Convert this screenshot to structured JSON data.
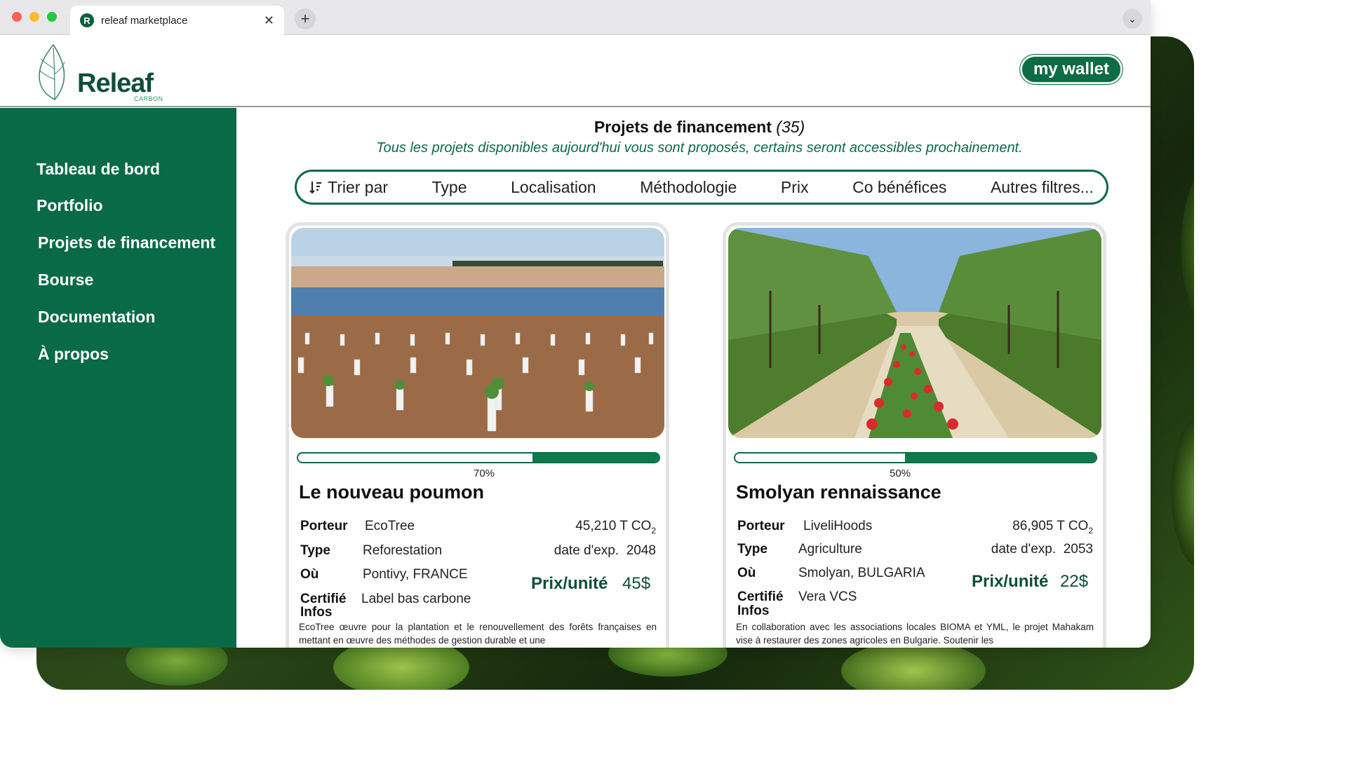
{
  "browser": {
    "tab_title": "releaf marketplace",
    "favicon_letter": "R",
    "close_glyph": "✕",
    "newtab_glyph": "+",
    "menu_glyph": "⌄"
  },
  "header": {
    "logo_name": "Releaf",
    "logo_sub": "CARBON",
    "wallet_label": "my wallet"
  },
  "sidebar": {
    "items": [
      {
        "label": "Tableau de bord"
      },
      {
        "label": "Portfolio"
      },
      {
        "label": "Projets de financement"
      },
      {
        "label": "Bourse"
      },
      {
        "label": "Documentation"
      },
      {
        "label": "À propos"
      }
    ]
  },
  "main": {
    "heading": "Projets de financement",
    "count": "(35)",
    "subtitle": "Tous les projets disponibles aujourd'hui vous sont proposés, certains seront accessibles prochainement.",
    "filters": {
      "sort": "Trier par",
      "type": "Type",
      "location": "Localisation",
      "methodology": "Méthodologie",
      "price": "Prix",
      "cobenefits": "Co bénéfices",
      "others": "Autres filtres..."
    }
  },
  "colors": {
    "brand_green": "#0d6b45",
    "sidebar_green": "#086b45"
  },
  "projects": [
    {
      "progress_pct": "70%",
      "progress_fraction": 0.7,
      "title": "Le nouveau poumon",
      "porteur_label": "Porteur",
      "porteur": "EcoTree",
      "type_label": "Type",
      "type": "Reforestation",
      "ou_label": "Où",
      "ou": "Pontivy, FRANCE",
      "certifie_label": "Certifié",
      "certifie": "Label bas carbone",
      "infos_label": "Infos",
      "co2": "45,210 T CO",
      "co2_sub": "2",
      "exp_label": "date d'exp.",
      "exp": "2048",
      "price_label": "Prix/unité",
      "price": "45$",
      "info": "EcoTree œuvre pour la plantation et le renouvellement des forêts françaises en mettant en œuvre des méthodes de gestion durable et une"
    },
    {
      "progress_pct": "50%",
      "progress_fraction": 0.5,
      "title": "Smolyan rennaissance",
      "porteur_label": "Porteur",
      "porteur": "LiveliHoods",
      "type_label": "Type",
      "type": "Agriculture",
      "ou_label": "Où",
      "ou": "Smolyan, BULGARIA",
      "certifie_label": "Certifié",
      "certifie": "Vera VCS",
      "infos_label": "Infos",
      "co2": "86,905 T CO",
      "co2_sub": "2",
      "exp_label": "date d'exp.",
      "exp": "2053",
      "price_label": "Prix/unité",
      "price": "22$",
      "info": "En collaboration avec les associations locales BIOMA et YML, le projet Mahakam vise à restaurer des zones agricoles en Bulgarie. Soutenir les"
    }
  ]
}
